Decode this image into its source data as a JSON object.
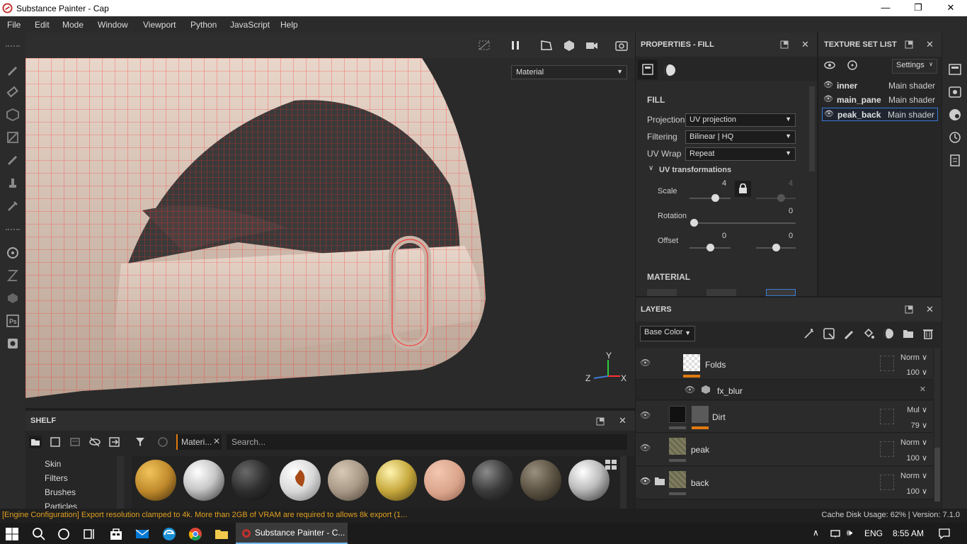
{
  "window": {
    "title": "Substance Painter - Cap",
    "minimize_glyph": "—",
    "maximize_glyph": "❐",
    "close_glyph": "✕"
  },
  "menu": [
    "File",
    "Edit",
    "Mode",
    "Window",
    "Viewport",
    "Python",
    "JavaScript",
    "Help"
  ],
  "viewport": {
    "display_mode": "Material",
    "axis_labels": {
      "x": "X",
      "y": "Y",
      "z": "Z"
    }
  },
  "shelf": {
    "title": "SHELF",
    "filter_tag": "Materi...",
    "search_placeholder": "Search...",
    "categories": [
      "Skin",
      "Filters",
      "Brushes",
      "Particles"
    ],
    "materials": [
      {
        "color": "#c08a2c",
        "name": "gold-hex"
      },
      {
        "color": "#c8c8c8",
        "name": "chrome"
      },
      {
        "color": "#2e2e2e",
        "name": "black-rubber"
      },
      {
        "color": "#d8d8d8",
        "name": "leaf-decal"
      },
      {
        "color": "#a89886",
        "name": "fabric-beige"
      },
      {
        "color": "#c6a83c",
        "name": "gold"
      },
      {
        "color": "#d9a38a",
        "name": "skin"
      },
      {
        "color": "#3a3a3a",
        "name": "carbon-fiber"
      },
      {
        "color": "#5a5142",
        "name": "old-metal"
      },
      {
        "color": "#bcbcbc",
        "name": "silver"
      }
    ]
  },
  "properties": {
    "title": "PROPERTIES - FILL",
    "section_fill": "FILL",
    "projection_label": "Projection",
    "projection_value": "UV projection",
    "filtering_label": "Filtering",
    "filtering_value": "Bilinear | HQ",
    "uvwrap_label": "UV Wrap",
    "uvwrap_value": "Repeat",
    "uv_transformations": "UV transformations",
    "scale_label": "Scale",
    "scale_value": "4",
    "scale_value_2": "4",
    "rotation_label": "Rotation",
    "rotation_value": "0",
    "offset_label": "Offset",
    "offset_x": "0",
    "offset_y": "0",
    "section_material": "MATERIAL"
  },
  "texture_set_list": {
    "title": "TEXTURE SET LIST",
    "settings_label": "Settings",
    "items": [
      {
        "name": "inner",
        "shader": "Main shader"
      },
      {
        "name": "main_pane",
        "shader": "Main shader"
      },
      {
        "name": "peak_back",
        "shader": "Main shader"
      }
    ]
  },
  "layers": {
    "title": "LAYERS",
    "channel": "Base Color",
    "rows": [
      {
        "name": "Folds",
        "blend": "Norm",
        "opacity": "100"
      },
      {
        "name": "fx_blur"
      },
      {
        "name": "Dirt",
        "blend": "Mul",
        "opacity": "79"
      },
      {
        "name": "peak",
        "blend": "Norm",
        "opacity": "100"
      },
      {
        "name": "back",
        "blend": "Norm",
        "opacity": "100"
      }
    ]
  },
  "status": {
    "message": "[Engine Configuration] Export resolution clamped to 4k. More than 2GB of VRAM are required to allows 8k export (1...",
    "cache": "Cache Disk Usage:  62% | Version: 7.1.0"
  },
  "taskbar": {
    "app_label": "Substance Painter - C...",
    "lang": "ENG",
    "time": "8:55 AM"
  },
  "colors": {
    "accent_orange": "#e07a10",
    "selection_blue": "#3a7bd5",
    "mesh_red": "#ff2a2a"
  }
}
